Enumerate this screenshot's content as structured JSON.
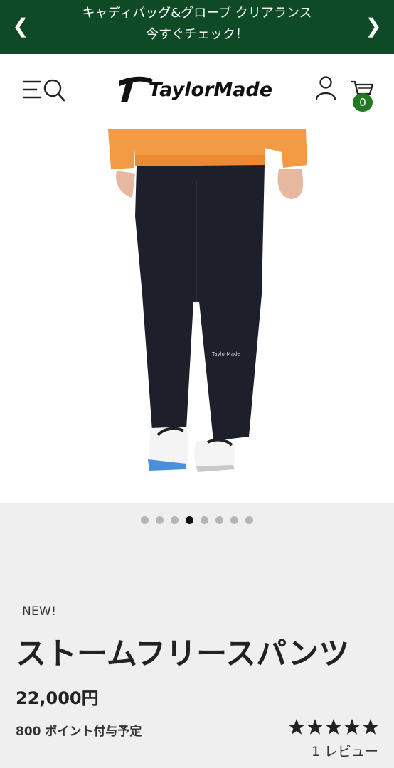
{
  "promo": {
    "line1": "キャディバッグ&グローブ クリアランス",
    "line2": "今すぐチェック！",
    "prev_icon": "chevron-left",
    "next_icon": "chevron-right",
    "background": "#0f4a26"
  },
  "header": {
    "menu_icon": "hamburger-search",
    "logo_text": "TaylorMade",
    "account_icon": "user",
    "cart_icon": "shopping-cart",
    "cart_count": "0",
    "cart_badge_color": "#1f7a22"
  },
  "gallery": {
    "image_count": 8,
    "active_index": 3
  },
  "product": {
    "badge": "NEW!",
    "name": "ストームフリースパンツ",
    "price": "22,000円",
    "points": "800 ポイント付与予定",
    "rating": 5,
    "reviews": "1 レビュー"
  }
}
